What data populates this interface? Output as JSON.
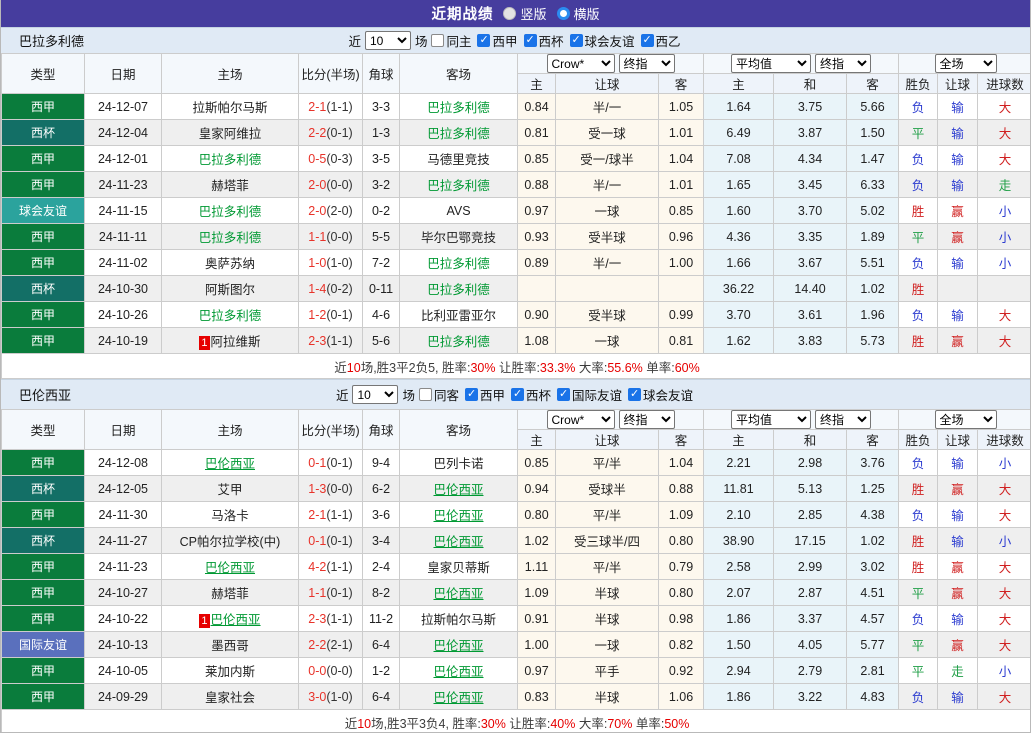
{
  "topbar": {
    "title": "近期战绩",
    "vertical_label": "竖版",
    "horizontal_label": "横版",
    "vertical_checked": false,
    "horizontal_checked": true
  },
  "colors": {
    "bar": "#463d9e",
    "type": {
      "西甲": "#0a7c3c",
      "西杯": "#136f66",
      "球会友谊": "#2ba39d",
      "国际友谊": "#5a70bd"
    },
    "result": {
      "胜": "#d02020",
      "赢": "#d02020",
      "大": "#d02020",
      "负": "#2b3bd0",
      "输": "#2b3bd0",
      "小": "#2b3bd0",
      "平": "#1f9e46",
      "走": "#1f9e46"
    },
    "team_link": "#009933",
    "score_red": "#e8332a"
  },
  "table_header": {
    "type": "类型",
    "date": "日期",
    "home": "主场",
    "score": "比分(半场)",
    "corner": "角球",
    "away": "客场",
    "odds_home": "主",
    "odds_handicap": "让球",
    "odds_away": "客",
    "avg_home": "主",
    "avg_draw": "和",
    "avg_away": "客",
    "res_wdl": "胜负",
    "res_handicap": "让球",
    "res_goals": "进球数",
    "odds_source_select": "Crow*",
    "final_select": "终指",
    "avg_select": "平均值",
    "scope_select": "全场"
  },
  "sections": [
    {
      "team": "巴拉多利德",
      "self_underline": false,
      "filter": {
        "near": "近",
        "count": "10",
        "games": "场",
        "checkboxes": [
          {
            "label": "同主",
            "checked": false
          },
          {
            "label": "西甲",
            "checked": true
          },
          {
            "label": "西杯",
            "checked": true
          },
          {
            "label": "球会友谊",
            "checked": true
          },
          {
            "label": "西乙",
            "checked": true
          }
        ]
      },
      "rows": [
        {
          "type": "西甲",
          "date": "24-12-07",
          "home": "拉斯帕尔马斯",
          "home_self": false,
          "home_badge": "",
          "score": "2-1",
          "half": "(1-1)",
          "corner": "3-3",
          "away": "巴拉多利德",
          "away_self": true,
          "odds": [
            "0.84",
            "半/一",
            "1.05"
          ],
          "avg": [
            "1.64",
            "3.75",
            "5.66"
          ],
          "result": [
            "负",
            "输",
            "大"
          ]
        },
        {
          "type": "西杯",
          "date": "24-12-04",
          "home": "皇家阿维拉",
          "home_self": false,
          "home_badge": "",
          "score": "2-2",
          "half": "(0-1)",
          "corner": "1-3",
          "away": "巴拉多利德",
          "away_self": true,
          "odds": [
            "0.81",
            "受一球",
            "1.01"
          ],
          "avg": [
            "6.49",
            "3.87",
            "1.50"
          ],
          "result": [
            "平",
            "输",
            "大"
          ]
        },
        {
          "type": "西甲",
          "date": "24-12-01",
          "home": "巴拉多利德",
          "home_self": true,
          "home_badge": "",
          "score": "0-5",
          "half": "(0-3)",
          "corner": "3-5",
          "away": "马德里竞技",
          "away_self": false,
          "odds": [
            "0.85",
            "受一/球半",
            "1.04"
          ],
          "avg": [
            "7.08",
            "4.34",
            "1.47"
          ],
          "result": [
            "负",
            "输",
            "大"
          ]
        },
        {
          "type": "西甲",
          "date": "24-11-23",
          "home": "赫塔菲",
          "home_self": false,
          "home_badge": "",
          "score": "2-0",
          "half": "(0-0)",
          "corner": "3-2",
          "away": "巴拉多利德",
          "away_self": true,
          "odds": [
            "0.88",
            "半/一",
            "1.01"
          ],
          "avg": [
            "1.65",
            "3.45",
            "6.33"
          ],
          "result": [
            "负",
            "输",
            "走"
          ]
        },
        {
          "type": "球会友谊",
          "date": "24-11-15",
          "home": "巴拉多利德",
          "home_self": true,
          "home_badge": "",
          "score": "2-0",
          "half": "(2-0)",
          "corner": "0-2",
          "away": "AVS",
          "away_self": false,
          "odds": [
            "0.97",
            "一球",
            "0.85"
          ],
          "avg": [
            "1.60",
            "3.70",
            "5.02"
          ],
          "result": [
            "胜",
            "赢",
            "小"
          ]
        },
        {
          "type": "西甲",
          "date": "24-11-11",
          "home": "巴拉多利德",
          "home_self": true,
          "home_badge": "",
          "score": "1-1",
          "half": "(0-0)",
          "corner": "5-5",
          "away": "毕尔巴鄂竞技",
          "away_self": false,
          "odds": [
            "0.93",
            "受半球",
            "0.96"
          ],
          "avg": [
            "4.36",
            "3.35",
            "1.89"
          ],
          "result": [
            "平",
            "赢",
            "小"
          ]
        },
        {
          "type": "西甲",
          "date": "24-11-02",
          "home": "奥萨苏纳",
          "home_self": false,
          "home_badge": "",
          "score": "1-0",
          "half": "(1-0)",
          "corner": "7-2",
          "away": "巴拉多利德",
          "away_self": true,
          "odds": [
            "0.89",
            "半/一",
            "1.00"
          ],
          "avg": [
            "1.66",
            "3.67",
            "5.51"
          ],
          "result": [
            "负",
            "输",
            "小"
          ]
        },
        {
          "type": "西杯",
          "date": "24-10-30",
          "home": "阿斯图尔",
          "home_self": false,
          "home_badge": "",
          "score": "1-4",
          "half": "(0-2)",
          "corner": "0-11",
          "away": "巴拉多利德",
          "away_self": true,
          "odds": [
            "",
            "",
            ""
          ],
          "avg": [
            "36.22",
            "14.40",
            "1.02"
          ],
          "result": [
            "胜",
            "",
            ""
          ]
        },
        {
          "type": "西甲",
          "date": "24-10-26",
          "home": "巴拉多利德",
          "home_self": true,
          "home_badge": "",
          "score": "1-2",
          "half": "(0-1)",
          "corner": "4-6",
          "away": "比利亚雷亚尔",
          "away_self": false,
          "odds": [
            "0.90",
            "受半球",
            "0.99"
          ],
          "avg": [
            "3.70",
            "3.61",
            "1.96"
          ],
          "result": [
            "负",
            "输",
            "大"
          ]
        },
        {
          "type": "西甲",
          "date": "24-10-19",
          "home": "阿拉维斯",
          "home_self": false,
          "home_badge": "1",
          "score": "2-3",
          "half": "(1-1)",
          "corner": "5-6",
          "away": "巴拉多利德",
          "away_self": true,
          "odds": [
            "1.08",
            "一球",
            "0.81"
          ],
          "avg": [
            "1.62",
            "3.83",
            "5.73"
          ],
          "result": [
            "胜",
            "赢",
            "大"
          ]
        }
      ],
      "summary": [
        {
          "t": "近",
          "red": false
        },
        {
          "t": "10",
          "red": true
        },
        {
          "t": "场,胜3平2负5, 胜率:",
          "red": false
        },
        {
          "t": "30%",
          "red": true
        },
        {
          "t": " 让胜率:",
          "red": false
        },
        {
          "t": "33.3%",
          "red": true
        },
        {
          "t": " 大率:",
          "red": false
        },
        {
          "t": "55.6%",
          "red": true
        },
        {
          "t": " 单率:",
          "red": false
        },
        {
          "t": "60%",
          "red": true
        }
      ]
    },
    {
      "team": "巴伦西亚",
      "self_underline": true,
      "filter": {
        "near": "近",
        "count": "10",
        "games": "场",
        "checkboxes": [
          {
            "label": "同客",
            "checked": false
          },
          {
            "label": "西甲",
            "checked": true
          },
          {
            "label": "西杯",
            "checked": true
          },
          {
            "label": "国际友谊",
            "checked": true
          },
          {
            "label": "球会友谊",
            "checked": true
          }
        ]
      },
      "rows": [
        {
          "type": "西甲",
          "date": "24-12-08",
          "home": "巴伦西亚",
          "home_self": true,
          "home_badge": "",
          "score": "0-1",
          "half": "(0-1)",
          "corner": "9-4",
          "away": "巴列卡诺",
          "away_self": false,
          "odds": [
            "0.85",
            "平/半",
            "1.04"
          ],
          "avg": [
            "2.21",
            "2.98",
            "3.76"
          ],
          "result": [
            "负",
            "输",
            "小"
          ]
        },
        {
          "type": "西杯",
          "date": "24-12-05",
          "home": "艾甲",
          "home_self": false,
          "home_badge": "",
          "score": "1-3",
          "half": "(0-0)",
          "corner": "6-2",
          "away": "巴伦西亚",
          "away_self": true,
          "odds": [
            "0.94",
            "受球半",
            "0.88"
          ],
          "avg": [
            "11.81",
            "5.13",
            "1.25"
          ],
          "result": [
            "胜",
            "赢",
            "大"
          ]
        },
        {
          "type": "西甲",
          "date": "24-11-30",
          "home": "马洛卡",
          "home_self": false,
          "home_badge": "",
          "score": "2-1",
          "half": "(1-1)",
          "corner": "3-6",
          "away": "巴伦西亚",
          "away_self": true,
          "odds": [
            "0.80",
            "平/半",
            "1.09"
          ],
          "avg": [
            "2.10",
            "2.85",
            "4.38"
          ],
          "result": [
            "负",
            "输",
            "大"
          ]
        },
        {
          "type": "西杯",
          "date": "24-11-27",
          "home": "CP帕尔拉学校(中)",
          "home_self": false,
          "home_badge": "",
          "score": "0-1",
          "half": "(0-1)",
          "corner": "3-4",
          "away": "巴伦西亚",
          "away_self": true,
          "odds": [
            "1.02",
            "受三球半/四",
            "0.80"
          ],
          "avg": [
            "38.90",
            "17.15",
            "1.02"
          ],
          "result": [
            "胜",
            "输",
            "小"
          ]
        },
        {
          "type": "西甲",
          "date": "24-11-23",
          "home": "巴伦西亚",
          "home_self": true,
          "home_badge": "",
          "score": "4-2",
          "half": "(1-1)",
          "corner": "2-4",
          "away": "皇家贝蒂斯",
          "away_self": false,
          "odds": [
            "1.11",
            "平/半",
            "0.79"
          ],
          "avg": [
            "2.58",
            "2.99",
            "3.02"
          ],
          "result": [
            "胜",
            "赢",
            "大"
          ]
        },
        {
          "type": "西甲",
          "date": "24-10-27",
          "home": "赫塔菲",
          "home_self": false,
          "home_badge": "",
          "score": "1-1",
          "half": "(0-1)",
          "corner": "8-2",
          "away": "巴伦西亚",
          "away_self": true,
          "odds": [
            "1.09",
            "半球",
            "0.80"
          ],
          "avg": [
            "2.07",
            "2.87",
            "4.51"
          ],
          "result": [
            "平",
            "赢",
            "大"
          ]
        },
        {
          "type": "西甲",
          "date": "24-10-22",
          "home": "巴伦西亚",
          "home_self": true,
          "home_badge": "1",
          "score": "2-3",
          "half": "(1-1)",
          "corner": "11-2",
          "away": "拉斯帕尔马斯",
          "away_self": false,
          "odds": [
            "0.91",
            "半球",
            "0.98"
          ],
          "avg": [
            "1.86",
            "3.37",
            "4.57"
          ],
          "result": [
            "负",
            "输",
            "大"
          ]
        },
        {
          "type": "国际友谊",
          "date": "24-10-13",
          "home": "墨西哥",
          "home_self": false,
          "home_badge": "",
          "score": "2-2",
          "half": "(2-1)",
          "corner": "6-4",
          "away": "巴伦西亚",
          "away_self": true,
          "odds": [
            "1.00",
            "一球",
            "0.82"
          ],
          "avg": [
            "1.50",
            "4.05",
            "5.77"
          ],
          "result": [
            "平",
            "赢",
            "大"
          ]
        },
        {
          "type": "西甲",
          "date": "24-10-05",
          "home": "莱加内斯",
          "home_self": false,
          "home_badge": "",
          "score": "0-0",
          "half": "(0-0)",
          "corner": "1-2",
          "away": "巴伦西亚",
          "away_self": true,
          "odds": [
            "0.97",
            "平手",
            "0.92"
          ],
          "avg": [
            "2.94",
            "2.79",
            "2.81"
          ],
          "result": [
            "平",
            "走",
            "小"
          ]
        },
        {
          "type": "西甲",
          "date": "24-09-29",
          "home": "皇家社会",
          "home_self": false,
          "home_badge": "",
          "score": "3-0",
          "half": "(1-0)",
          "corner": "6-4",
          "away": "巴伦西亚",
          "away_self": true,
          "odds": [
            "0.83",
            "半球",
            "1.06"
          ],
          "avg": [
            "1.86",
            "3.22",
            "4.83"
          ],
          "result": [
            "负",
            "输",
            "大"
          ]
        }
      ],
      "summary": [
        {
          "t": "近",
          "red": false
        },
        {
          "t": "10",
          "red": true
        },
        {
          "t": "场,胜3平3负4, 胜率:",
          "red": false
        },
        {
          "t": "30%",
          "red": true
        },
        {
          "t": " 让胜率:",
          "red": false
        },
        {
          "t": "40%",
          "red": true
        },
        {
          "t": " 大率:",
          "red": false
        },
        {
          "t": "70%",
          "red": true
        },
        {
          "t": " 单率:",
          "red": false
        },
        {
          "t": "50%",
          "red": true
        }
      ]
    }
  ]
}
